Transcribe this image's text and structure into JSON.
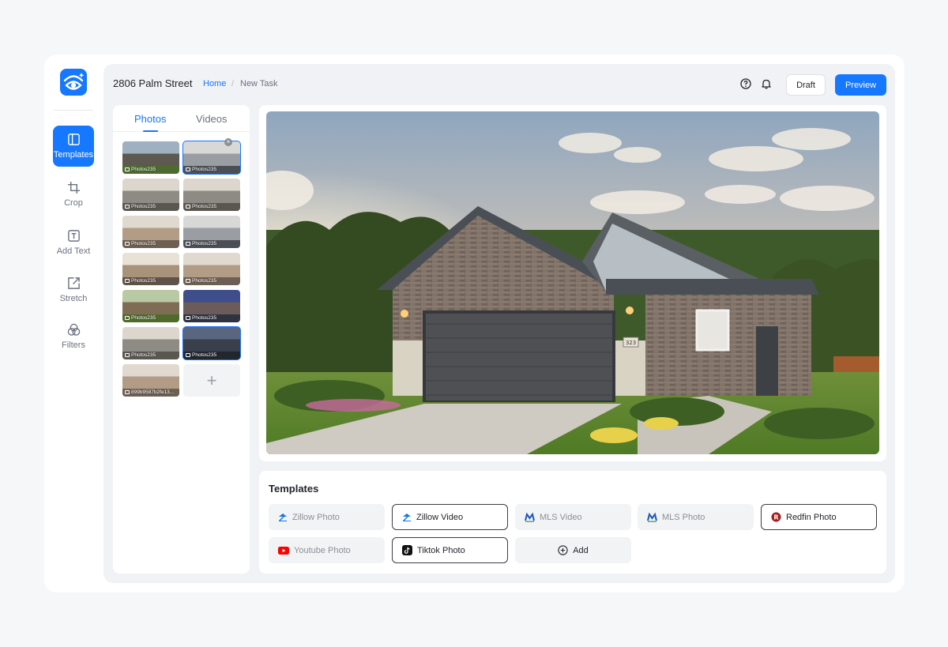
{
  "header": {
    "title": "2806 Palm Street",
    "breadcrumb": {
      "home": "Home",
      "separator": "/",
      "current": "New Task"
    },
    "draft_label": "Draft",
    "preview_label": "Preview"
  },
  "tools": [
    {
      "label": "Templates",
      "icon": "templates-icon",
      "active": true
    },
    {
      "label": "Crop",
      "icon": "crop-icon"
    },
    {
      "label": "Add Text",
      "icon": "add-text-icon"
    },
    {
      "label": "Stretch",
      "icon": "stretch-icon"
    },
    {
      "label": "Filters",
      "icon": "filters-icon"
    }
  ],
  "media": {
    "tabs": [
      "Photos",
      "Videos"
    ],
    "active_tab": "Photos",
    "thumbnails": [
      {
        "caption": "Photos235",
        "scene": "house-exterior"
      },
      {
        "caption": "Photos235",
        "scene": "bathroom",
        "selected": true
      },
      {
        "caption": "Photos235",
        "scene": "kitchen"
      },
      {
        "caption": "Photos235",
        "scene": "kitchen"
      },
      {
        "caption": "Photos235",
        "scene": "bedroom"
      },
      {
        "caption": "Photos235",
        "scene": "bathroom"
      },
      {
        "caption": "Photos235",
        "scene": "living-room"
      },
      {
        "caption": "Photos235",
        "scene": "bedroom"
      },
      {
        "caption": "Photos235",
        "scene": "patio"
      },
      {
        "caption": "Photos235",
        "scene": "house-dusk"
      },
      {
        "caption": "Photos235",
        "scene": "kitchen"
      },
      {
        "caption": "Photos235",
        "scene": "dining",
        "selected": true
      },
      {
        "caption": "899b9587b2fe13...",
        "scene": "bedroom"
      }
    ],
    "add_label": "+"
  },
  "templates": {
    "title": "Templates",
    "items": [
      {
        "label": "Zillow Photo",
        "icon": "zillow-icon",
        "selected": false
      },
      {
        "label": "Zillow Video",
        "icon": "zillow-icon",
        "selected": true
      },
      {
        "label": "MLS Video",
        "icon": "mls-icon",
        "selected": false
      },
      {
        "label": "MLS Photo",
        "icon": "mls-icon",
        "selected": false
      },
      {
        "label": "Redfin Photo",
        "icon": "redfin-icon",
        "selected": true
      },
      {
        "label": "Youtube Photo",
        "icon": "youtube-icon",
        "selected": false
      },
      {
        "label": "Tiktok Photo",
        "icon": "tiktok-icon",
        "selected": true
      }
    ],
    "add_label": "Add"
  },
  "photo": {
    "house_number": "323"
  },
  "colors": {
    "accent": "#1677ff",
    "zillow": "#1277e1",
    "redfin": "#a02021",
    "youtube": "#ff0000"
  }
}
